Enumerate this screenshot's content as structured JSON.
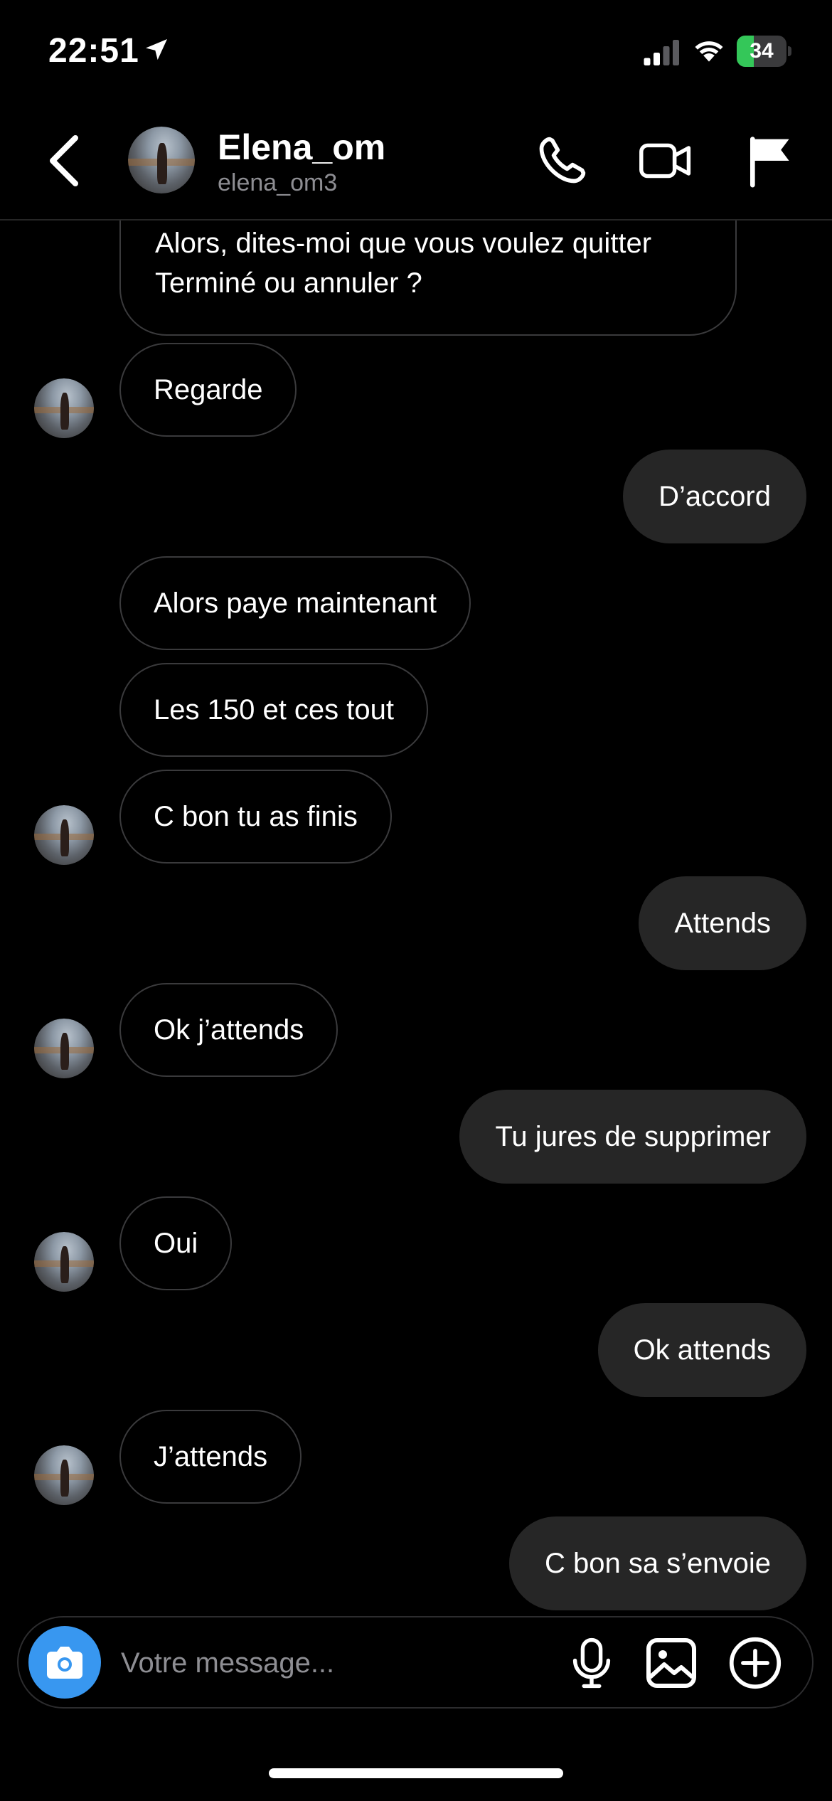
{
  "status_bar": {
    "time": "22:51",
    "battery": "34",
    "battery_level": 0.34,
    "icons": [
      "location-arrow-icon",
      "signal-icon",
      "wifi-icon",
      "battery-icon"
    ]
  },
  "header": {
    "name": "Elena_om",
    "username": "elena_om3",
    "icons": [
      "back-icon",
      "phone-icon",
      "video-icon",
      "flag-icon"
    ]
  },
  "messages": [
    {
      "dir": "in",
      "text": " Alors, dites-moi que vous voulez quitter Terminé ou annuler ?",
      "avatar": false
    },
    {
      "dir": "in",
      "text": "Regarde",
      "avatar": true
    },
    {
      "dir": "out",
      "text": "D’accord"
    },
    {
      "dir": "in",
      "text": "Alors paye maintenant",
      "avatar": false
    },
    {
      "dir": "in",
      "text": "Les 150 et ces tout",
      "avatar": false
    },
    {
      "dir": "in",
      "text": "C bon tu as finis",
      "avatar": true
    },
    {
      "dir": "out",
      "text": "Attends"
    },
    {
      "dir": "in",
      "text": "Ok j’attends",
      "avatar": true
    },
    {
      "dir": "out",
      "text": "Tu jures de supprimer"
    },
    {
      "dir": "in",
      "text": "Oui",
      "avatar": true
    },
    {
      "dir": "out",
      "text": "Ok attends"
    },
    {
      "dir": "in",
      "text": "J’attends",
      "avatar": true
    },
    {
      "dir": "out",
      "text": "C bon sa s’envoie"
    }
  ],
  "composer": {
    "placeholder": "Votre message...",
    "value": "",
    "icons": [
      "camera-icon",
      "microphone-icon",
      "gallery-icon",
      "plus-icon"
    ]
  },
  "colors": {
    "background": "#000000",
    "outgoing_bubble": "#262626",
    "incoming_border": "#3a3a3c",
    "camera_button": "#3897f0",
    "battery_fill": "#34c759"
  }
}
